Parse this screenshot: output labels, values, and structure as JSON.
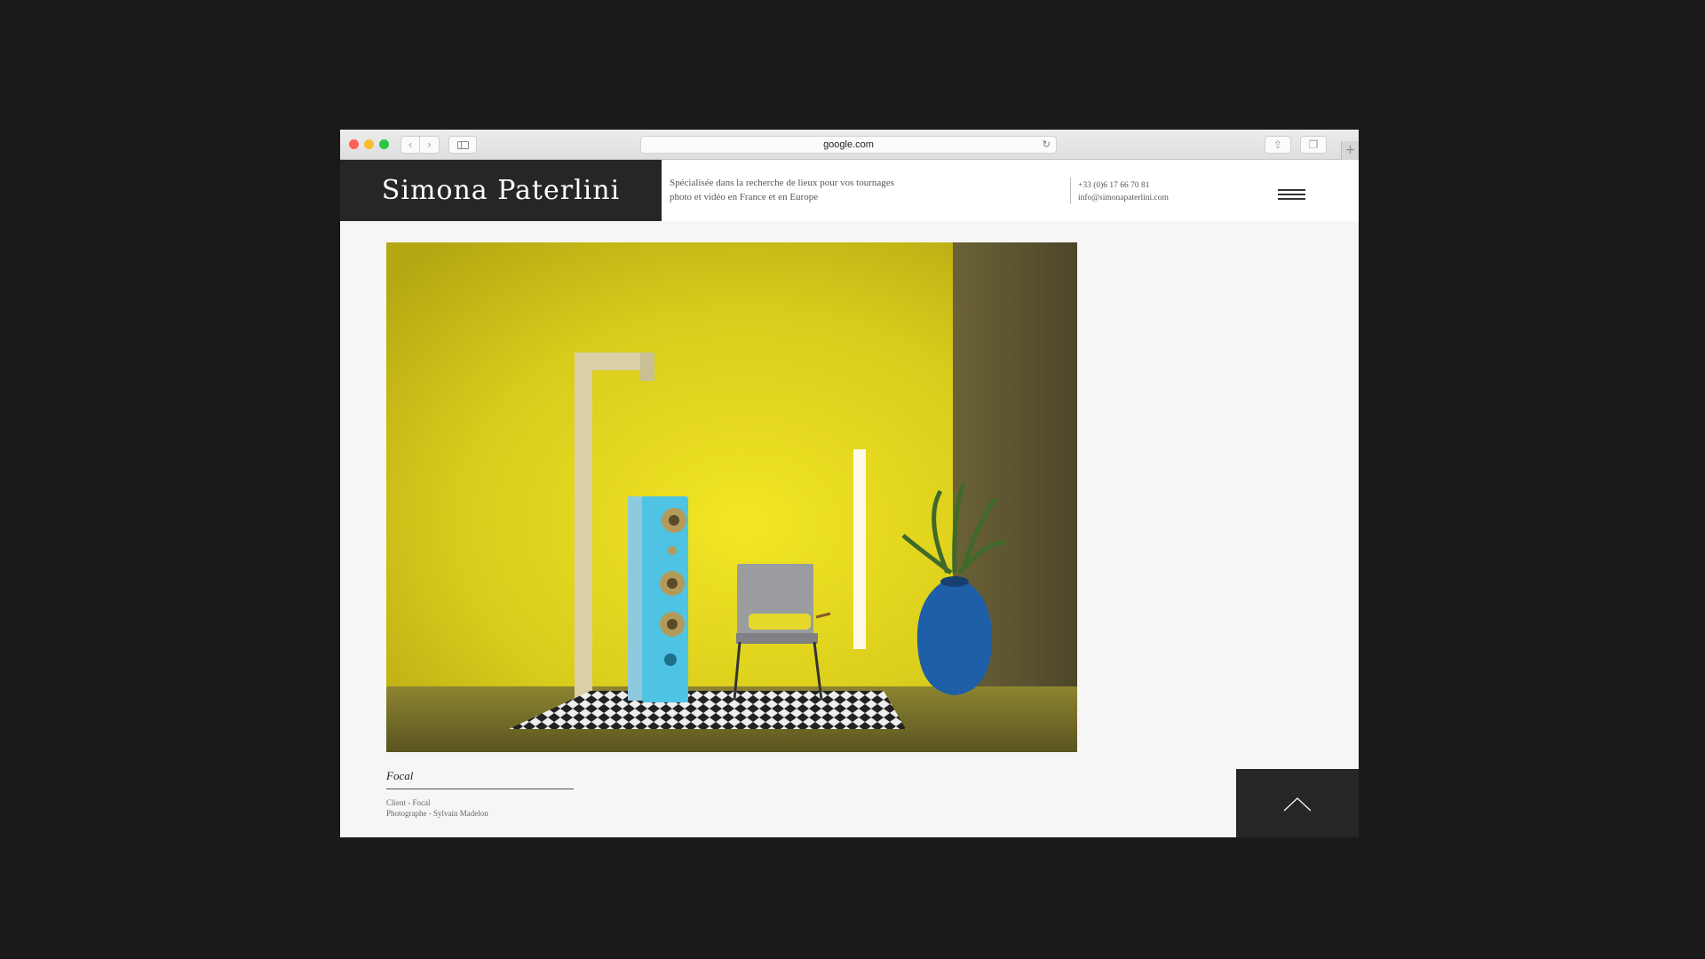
{
  "browser": {
    "url": "google.com",
    "icons": {
      "back": "chevron-left-icon",
      "forward": "chevron-right-icon",
      "sidebar": "sidebar-icon",
      "reload": "reload-icon",
      "share": "share-icon",
      "tabs": "tabs-icon",
      "new_tab": "plus-icon"
    }
  },
  "site": {
    "logo": "Simona Paterlini",
    "tagline": [
      "Spécialisée dans la recherche de lieux pour vos tournages",
      "photo et vidéo en France et en Europe"
    ],
    "phone": "+33 (0)6 17 66 70 81",
    "email": "info@simonapaterlini.com",
    "menu_icon": "hamburger-menu-icon"
  },
  "project": {
    "title": "Focal",
    "client": "Client - Focal",
    "photographer": "Photographe - Sylvain Madelon",
    "back_to_top_icon": "chevron-up-icon"
  },
  "colors": {
    "page_background": "#1a1a1a",
    "logo_background": "#262626",
    "photo_wall_yellow": "#d8cb1c",
    "speaker_blue": "#4fc3e3"
  }
}
